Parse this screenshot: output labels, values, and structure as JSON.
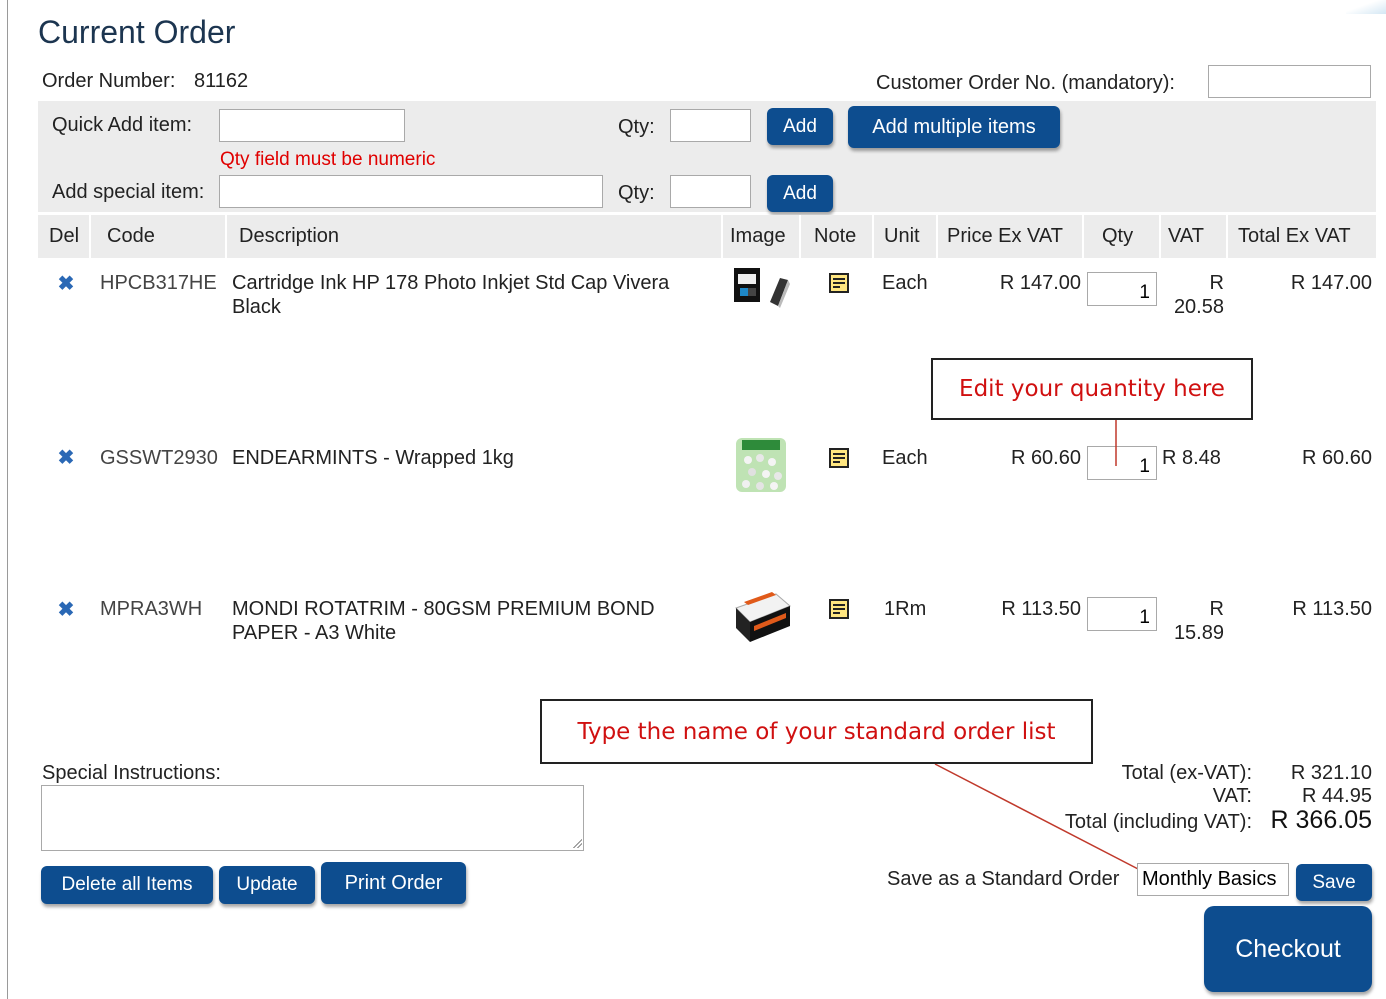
{
  "page": {
    "title": "Current Order",
    "order_number_label": "Order Number:",
    "order_number": "81162",
    "customer_order_label": "Customer Order No. (mandatory):",
    "customer_order_value": ""
  },
  "quick_add": {
    "item_label": "Quick Add item:",
    "qty_label": "Qty:",
    "add_label": "Add",
    "add_multiple_label": "Add multiple items",
    "error_text": "Qty field must be numeric",
    "special_label": "Add special item:",
    "special_qty_label": "Qty:",
    "special_add_label": "Add"
  },
  "table": {
    "headers": [
      "Del",
      "Code",
      "Description",
      "Image",
      "Note",
      "Unit",
      "Price Ex VAT",
      "Qty",
      "VAT",
      "Total Ex VAT"
    ],
    "rows": [
      {
        "code": "HPCB317HE",
        "description_line1": "Cartridge Ink HP 178 Photo Inkjet Std Cap Vivera",
        "description_line2": "Black",
        "unit": "Each",
        "price": "R 147.00",
        "qty": "1",
        "vat_line1": "R",
        "vat_line2": "20.58",
        "total": "R 147.00",
        "image": "ink-cartridge-image"
      },
      {
        "code": "GSSWT2930",
        "description_line1": "ENDEARMINTS - Wrapped 1kg",
        "description_line2": "",
        "unit": "Each",
        "price": "R 60.60",
        "qty": "1",
        "vat_line1": "R 8.48",
        "vat_line2": "",
        "total": "R 60.60",
        "image": "mints-bag-image"
      },
      {
        "code": "MPRA3WH",
        "description_line1": "MONDI ROTATRIM - 80GSM PREMIUM BOND",
        "description_line2": "PAPER - A3 White",
        "unit": "1Rm",
        "price": "R 113.50",
        "qty": "1",
        "vat_line1": "R",
        "vat_line2": "15.89",
        "total": "R 113.50",
        "image": "paper-ream-image"
      }
    ]
  },
  "callouts": {
    "qty": "Edit your quantity here",
    "standard_order": "Type the name of your standard order list"
  },
  "footer": {
    "special_instructions_label": "Special Instructions:",
    "total_ex_vat_label": "Total (ex-VAT):",
    "total_ex_vat": "R 321.10",
    "vat_label": "VAT:",
    "vat": "R 44.95",
    "total_incl_label": "Total (including VAT):",
    "total_incl": "R 366.05",
    "save_standard_label": "Save as a Standard Order",
    "standard_order_name": "Monthly Basics",
    "save_label": "Save",
    "delete_all_label": "Delete all Items",
    "update_label": "Update",
    "print_label": "Print Order",
    "checkout_label": "Checkout"
  },
  "colors": {
    "button": "#0d4d8f",
    "error": "#e00000",
    "callout_text": "#d01010",
    "title": "#1c3550",
    "del_icon": "#2a68b5"
  }
}
